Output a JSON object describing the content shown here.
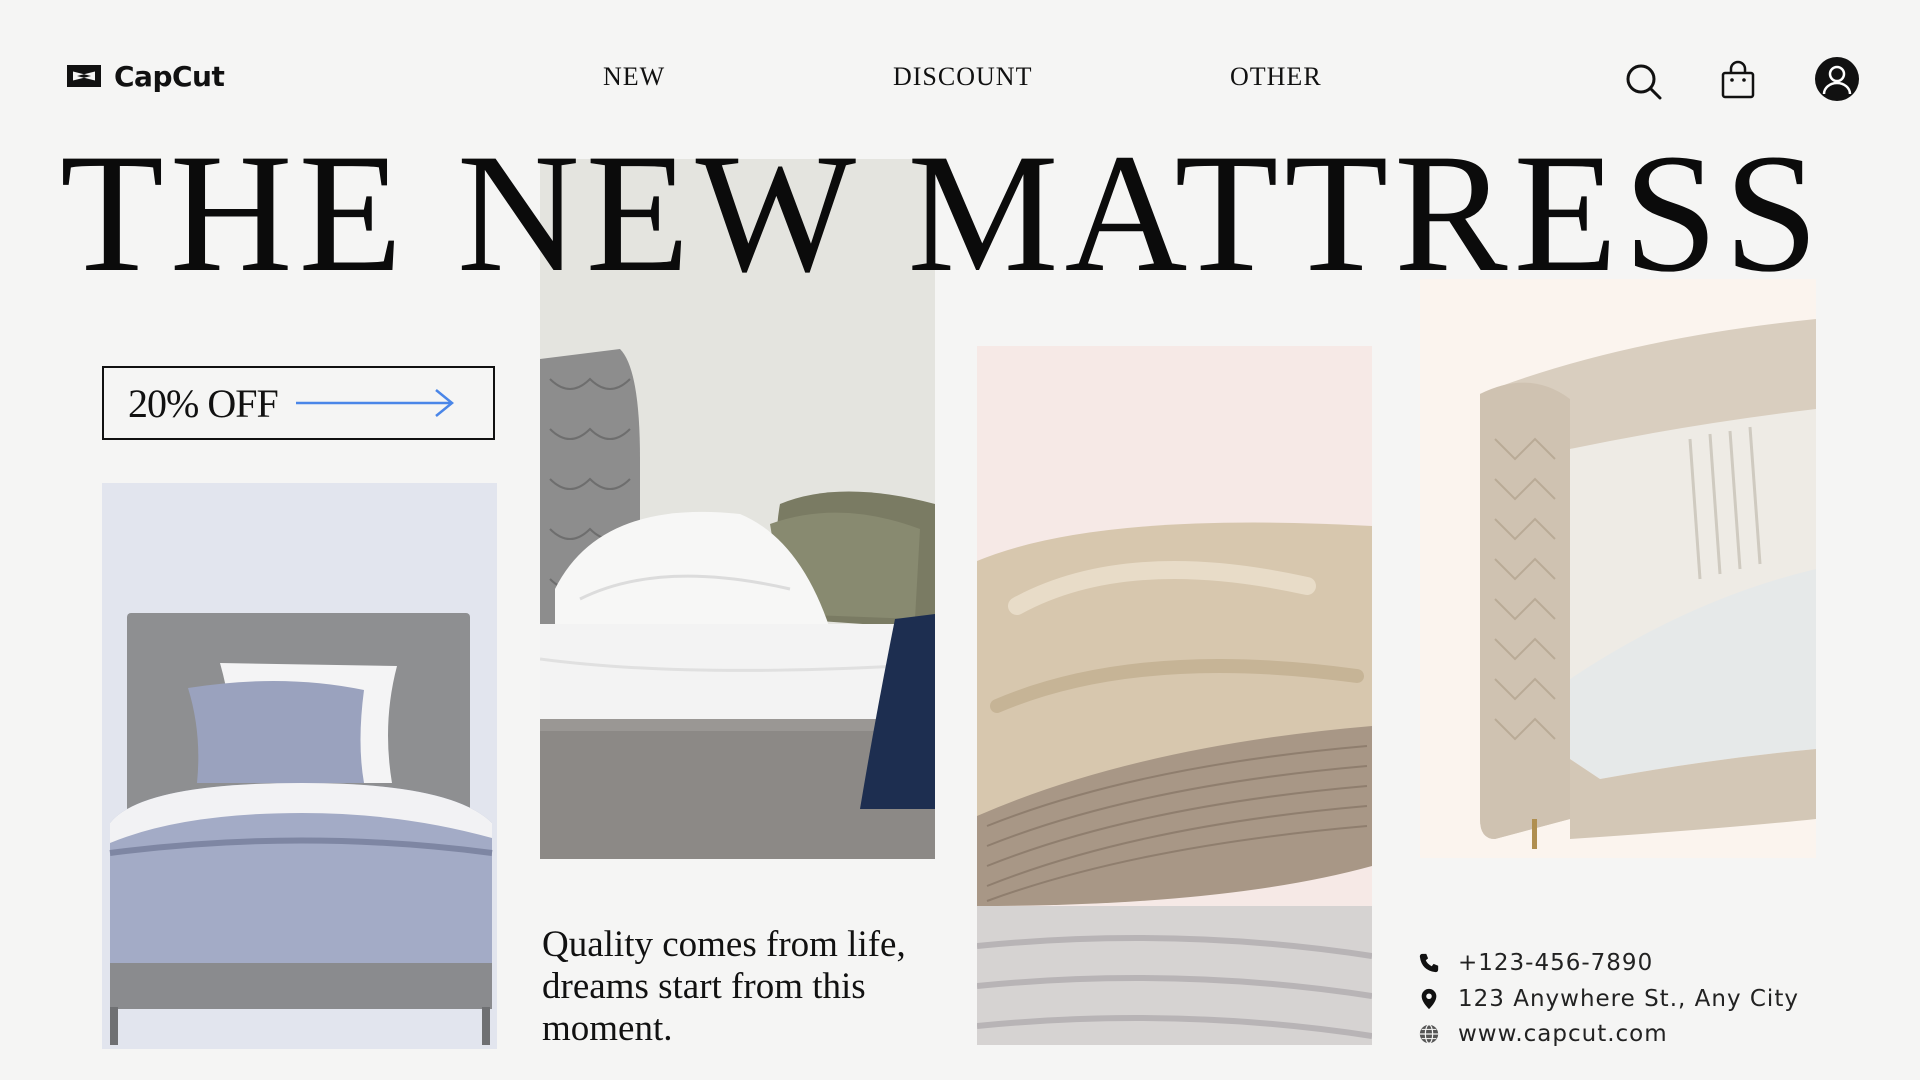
{
  "header": {
    "logo_text": "CapCut",
    "nav": [
      "NEW",
      "DISCOUNT",
      "OTHER"
    ],
    "icons": [
      "search-icon",
      "shopping-bag-icon",
      "user-avatar-icon"
    ]
  },
  "hero": {
    "title": "THE NEW MATTRESS",
    "promo_label": "20% OFF",
    "tagline": "Quality comes from life, dreams start from this moment."
  },
  "photos": [
    "single-bed-photo",
    "pillows-bed-photo",
    "beige-bedding-photo",
    "leather-bed-frame-photo"
  ],
  "contact": {
    "phone": "+123-456-7890",
    "address": "123 Anywhere St., Any City",
    "website": "www.capcut.com"
  },
  "colors": {
    "background": "#f5f5f4",
    "text": "#111111",
    "accent_arrow": "#4a86e8"
  }
}
